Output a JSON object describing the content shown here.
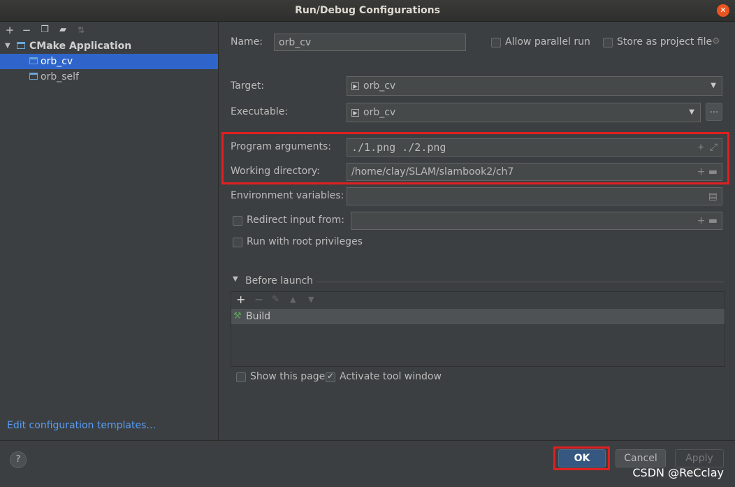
{
  "window": {
    "title": "Run/Debug Configurations",
    "close_icon": "close-icon"
  },
  "left": {
    "toolbar": [
      "add-icon",
      "remove-icon",
      "copy-icon",
      "move-into-folder-icon",
      "sort-icon"
    ],
    "tree": {
      "group": "CMake Application",
      "items": [
        {
          "label": "orb_cv",
          "selected": true
        },
        {
          "label": "orb_self",
          "selected": false
        }
      ]
    },
    "edit_templates": "Edit configuration templates…"
  },
  "form": {
    "name_label": "Name:",
    "name_value": "orb_cv",
    "allow_parallel": "Allow parallel run",
    "store_project": "Store as project file",
    "target_label": "Target:",
    "target_value": "orb_cv",
    "executable_label": "Executable:",
    "executable_value": "orb_cv",
    "browse_label": "...",
    "program_args_label": "Program arguments:",
    "program_args_value": "./1.png ./2.png",
    "working_dir_label": "Working directory:",
    "working_dir_value": "/home/clay/SLAM/slambook2/ch7",
    "env_label": "Environment variables:",
    "env_value": "",
    "redirect_label": "Redirect input from:",
    "redirect_value": "",
    "root_priv_label": "Run with root privileges"
  },
  "before_launch": {
    "title": "Before launch",
    "items": [
      "Build"
    ]
  },
  "options": {
    "show_page": "Show this page",
    "show_page_checked": false,
    "activate_tool": "Activate tool window",
    "activate_tool_checked": true
  },
  "buttons": {
    "help": "?",
    "ok": "OK",
    "cancel": "Cancel",
    "apply": "Apply"
  },
  "watermark": "CSDN @ReCclay",
  "colors": {
    "accent": "#2f65ca",
    "highlight": "#e02020",
    "ok_button": "#365880"
  }
}
